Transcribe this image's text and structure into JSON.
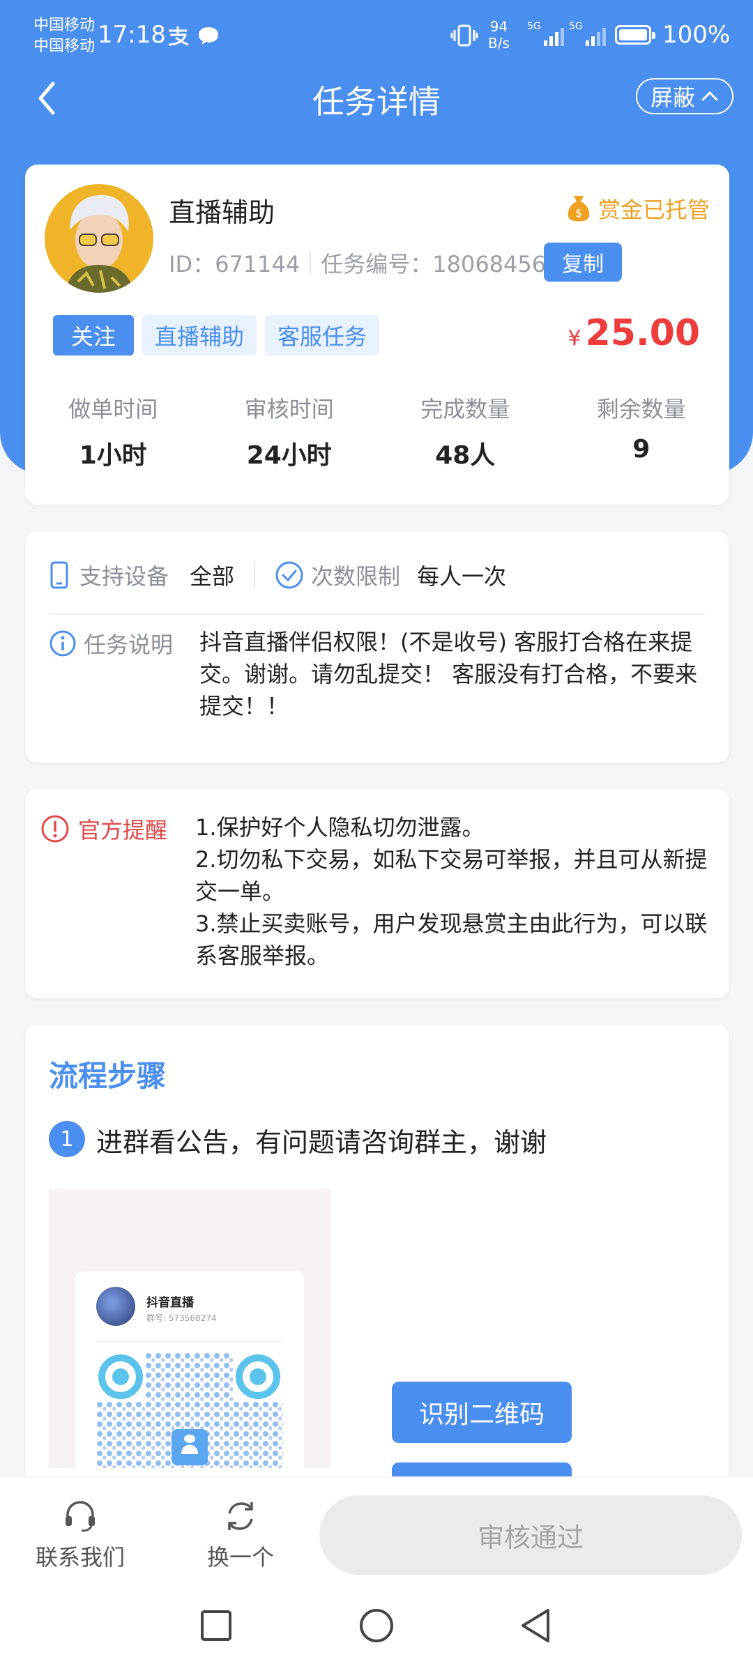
{
  "status_bar": {
    "carrier1": "中国移动",
    "carrier2": "中国移动",
    "time": "17:18",
    "net_speed": "94",
    "net_unit": "B/s",
    "sig1_label": "5G",
    "sig2_label": "5G",
    "battery": "100%"
  },
  "nav": {
    "title": "任务详情",
    "shield_label": "屏蔽"
  },
  "task": {
    "name": "直播辅助",
    "id_text": "ID：671144",
    "number_text": "任务编号：18068456",
    "copy_label": "复制",
    "escrow_label": "赏金已托管",
    "tags": [
      "关注",
      "直播辅助",
      "客服任务"
    ],
    "currency": "¥",
    "price": "25.00",
    "stats": [
      {
        "label": "做单时间",
        "value": "1小时"
      },
      {
        "label": "审核时间",
        "value": "24小时"
      },
      {
        "label": "完成数量",
        "value": "48人"
      },
      {
        "label": "剩余数量",
        "value": "9"
      }
    ]
  },
  "info": {
    "device_label": "支持设备",
    "device_value": "全部",
    "limit_label": "次数限制",
    "limit_value": "每人一次",
    "desc_label": "任务说明",
    "desc_text": "抖音直播伴侣权限！(不是收号) 客服打合格在来提交。谢谢。请勿乱提交！ 客服没有打合格，不要来提交！！"
  },
  "notice": {
    "label": "官方提醒",
    "lines": [
      "1.保护好个人隐私切勿泄露。",
      "2.切勿私下交易，如私下交易可举报，并且可从新提交一单。",
      "3.禁止买卖账号，用户发现悬赏主由此行为，可以联系客服举报。"
    ]
  },
  "steps": {
    "title": "流程步骤",
    "step1_num": "1",
    "step1_text": "进群看公告，有问题请咨询群主，谢谢",
    "qr_group_name": "抖音直播",
    "qr_group_id": "群号: 573568274",
    "scan_button": "识别二维码"
  },
  "bottom": {
    "contact_label": "联系我们",
    "switch_label": "换一个",
    "approve_label": "审核通过"
  },
  "colors": {
    "brand": "#4a8ff0",
    "price": "#ee3b3b",
    "warn": "#e14848",
    "escrow": "#f0a020"
  }
}
